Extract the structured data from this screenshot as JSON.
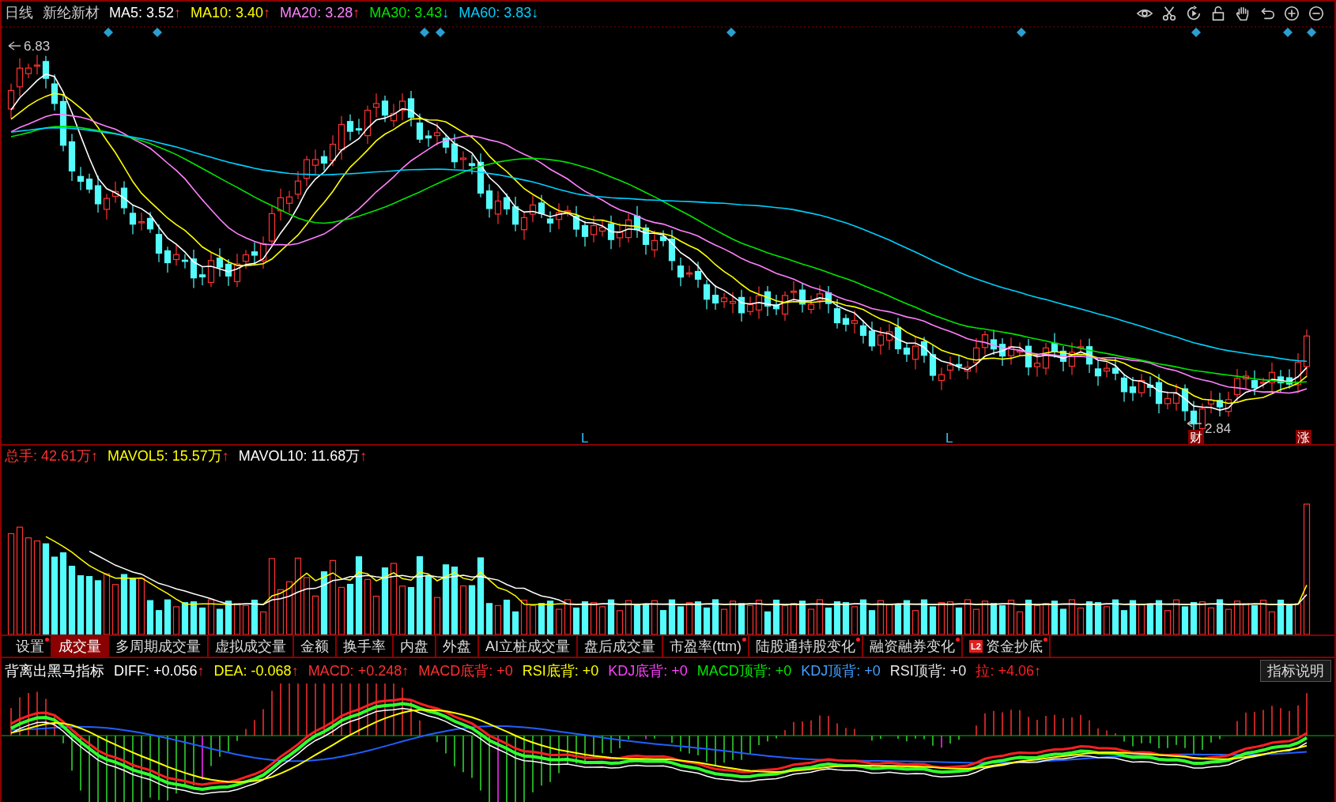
{
  "header": {
    "period": "日线",
    "stock": "新纶新材"
  },
  "ma_legend": [
    {
      "text": "MA5: 3.52",
      "arrow": "↑",
      "rising": true,
      "color": "#ffffff"
    },
    {
      "text": "MA10: 3.40",
      "arrow": "↑",
      "rising": true,
      "color": "#ffff00"
    },
    {
      "text": "MA20: 3.28",
      "arrow": "↑",
      "rising": true,
      "color": "#ff80ff"
    },
    {
      "text": "MA30: 3.43",
      "arrow": "↓",
      "rising": false,
      "color": "#00e600"
    },
    {
      "text": "MA60: 3.83",
      "arrow": "↓",
      "rising": false,
      "color": "#00d0ff"
    }
  ],
  "price_chart": {
    "high_label": "6.83",
    "low_label": "2.84",
    "marks": [
      "L",
      "L"
    ],
    "badges": [
      "财",
      "涨"
    ]
  },
  "volume_legend": [
    {
      "text": "总手: 42.61万",
      "arrow": "↑",
      "rising": true,
      "color": "#ff3030"
    },
    {
      "text": "MAVOL5: 15.57万",
      "arrow": "↑",
      "rising": true,
      "color": "#ffff00"
    },
    {
      "text": "MAVOL10: 11.68万",
      "arrow": "↑",
      "rising": true,
      "color": "#ffffff"
    }
  ],
  "tabs": [
    {
      "label": "设置",
      "selected": false,
      "dot": true
    },
    {
      "label": "成交量",
      "selected": true,
      "dot": false
    },
    {
      "label": "多周期成交量",
      "selected": false,
      "dot": false
    },
    {
      "label": "虚拟成交量",
      "selected": false,
      "dot": false
    },
    {
      "label": "金额",
      "selected": false,
      "dot": false
    },
    {
      "label": "换手率",
      "selected": false,
      "dot": false
    },
    {
      "label": "内盘",
      "selected": false,
      "dot": false
    },
    {
      "label": "外盘",
      "selected": false,
      "dot": false
    },
    {
      "label": "AI立桩成交量",
      "selected": false,
      "dot": false
    },
    {
      "label": "盘后成交量",
      "selected": false,
      "dot": false
    },
    {
      "label": "市盈率(ttm)",
      "selected": false,
      "dot": true
    },
    {
      "label": "陆股通持股变化",
      "selected": false,
      "dot": true
    },
    {
      "label": "融资融券变化",
      "selected": false,
      "dot": true
    },
    {
      "label": "资金抄底",
      "selected": false,
      "dot": true,
      "badge": "L2"
    }
  ],
  "macd_legend": [
    {
      "text": "背离出黑马指标",
      "color": "#ffffff"
    },
    {
      "text": "DIFF: +0.056",
      "arrow": "↑",
      "rising": true,
      "color": "#ffffff"
    },
    {
      "text": "DEA: -0.068",
      "arrow": "↑",
      "rising": true,
      "color": "#ffff00"
    },
    {
      "text": "MACD: +0.248",
      "arrow": "↑",
      "rising": true,
      "color": "#ff3030"
    },
    {
      "text": "MACD底背: +0",
      "color": "#ff3030"
    },
    {
      "text": "RSI底背: +0",
      "color": "#ffff00"
    },
    {
      "text": "KDJ底背: +0",
      "color": "#ff40ff"
    },
    {
      "text": "MACD顶背: +0",
      "color": "#00e600"
    },
    {
      "text": "KDJ顶背: +0",
      "color": "#40a0ff"
    },
    {
      "text": "RSI顶背: +0",
      "color": "#e8e8e8"
    },
    {
      "text": "拉: +4.06",
      "arrow": "↑",
      "rising": true,
      "color": "#ff2020"
    }
  ],
  "indicator_help_button": "指标说明"
}
